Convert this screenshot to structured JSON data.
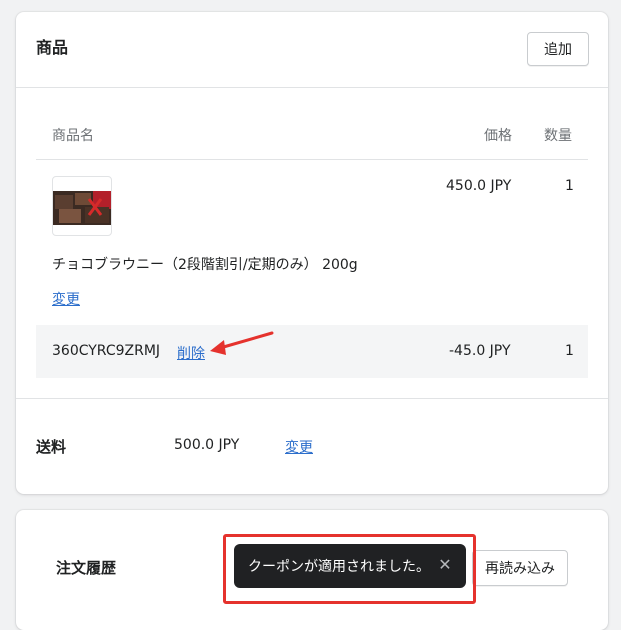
{
  "products": {
    "title": "商品",
    "add_label": "追加",
    "columns": {
      "name": "商品名",
      "price": "価格",
      "qty": "数量"
    },
    "item": {
      "name": "チョコブラウニー（2段階割引/定期のみ） 200g",
      "price": "450.0 JPY",
      "qty": "1",
      "change_label": "変更"
    },
    "coupon": {
      "code": "360CYRC9ZRMJ",
      "delete_label": "削除",
      "price": "-45.0 JPY",
      "qty": "1"
    },
    "shipping": {
      "label": "送料",
      "value": "500.0 JPY",
      "change_label": "変更"
    }
  },
  "history": {
    "title": "注文履歴",
    "reload_label": "再読み込み"
  },
  "toast": {
    "message": "クーポンが適用されました。",
    "close_icon": "close-icon"
  },
  "annotation_color": "#e5322d"
}
